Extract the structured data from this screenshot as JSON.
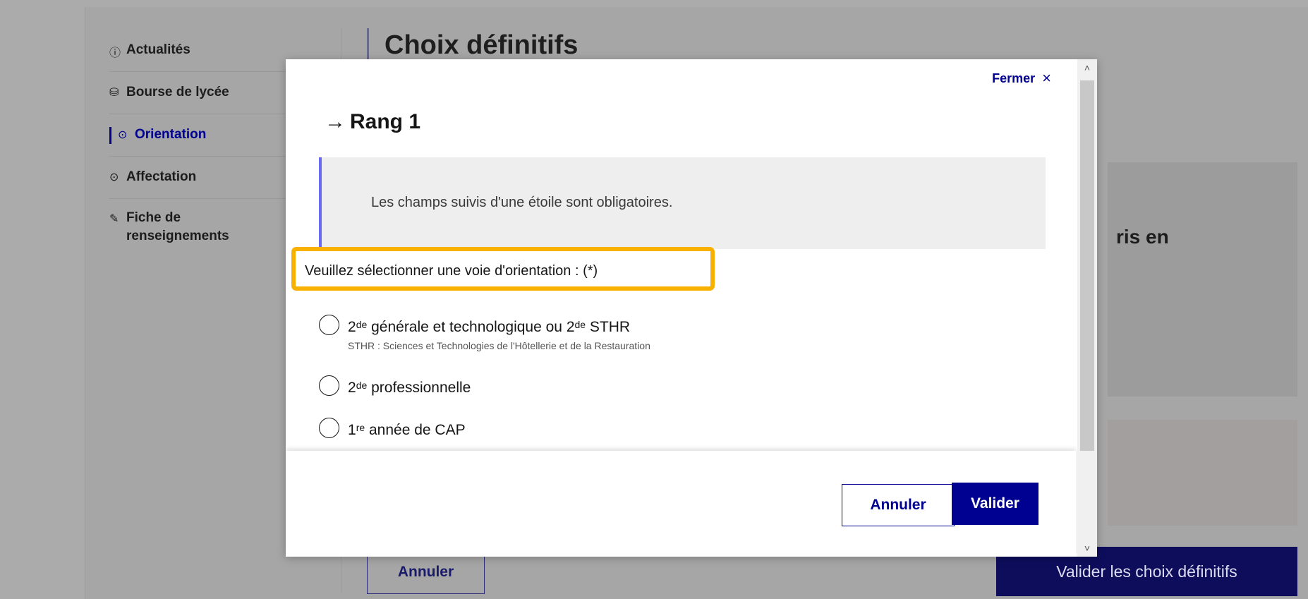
{
  "sidebar": {
    "items": [
      {
        "icon": "info-icon",
        "glyph": "ⓘ",
        "label": "Actualités"
      },
      {
        "icon": "scholarship-icon",
        "glyph": "⛁",
        "label": "Bourse de lycée"
      },
      {
        "icon": "compass-icon",
        "glyph": "⊙",
        "label": "Orientation"
      },
      {
        "icon": "target-icon",
        "glyph": "⊙",
        "label": "Affectation"
      },
      {
        "icon": "edit-icon",
        "glyph": "✎",
        "label": "Fiche de renseignements"
      }
    ],
    "active_index": 2
  },
  "background": {
    "title": "Choix définitifs",
    "card_text": "ris en",
    "cancel_label": "Annuler",
    "submit_label": "Valider les choix définitifs"
  },
  "modal": {
    "close_label": "Fermer",
    "close_icon": "×",
    "title_arrow": "→",
    "title": "Rang 1",
    "notice": "Les champs suivis d'une étoile sont obligatoires.",
    "legend": "Veuillez sélectionner une voie d'orientation : (*)",
    "options": [
      {
        "pre": "2",
        "sup": "de",
        "text": " générale et technologique ou 2",
        "sup2": "de",
        "post": " STHR",
        "hint": "STHR : Sciences et Technologies de l'Hôtellerie et de la Restauration"
      },
      {
        "pre": "2",
        "sup": "de",
        "text": " professionnelle",
        "sup2": "",
        "post": "",
        "hint": ""
      },
      {
        "pre": "1",
        "sup": "re",
        "text": " année de CAP",
        "sup2": "",
        "post": "",
        "hint": ""
      }
    ],
    "cancel_label": "Annuler",
    "validate_label": "Valider"
  },
  "colors": {
    "accent": "#000091",
    "highlight": "#f8b100",
    "notice_border": "#6a6af4"
  }
}
